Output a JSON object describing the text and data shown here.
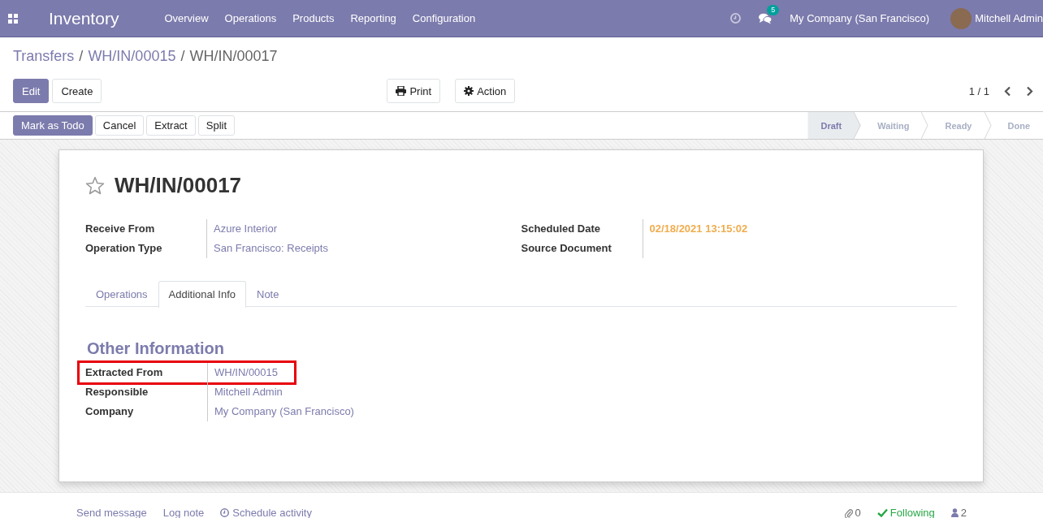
{
  "navbar": {
    "app_title": "Inventory",
    "menu": [
      "Overview",
      "Operations",
      "Products",
      "Reporting",
      "Configuration"
    ],
    "message_count": "5",
    "company": "My Company (San Francisco)",
    "user": "Mitchell Admin"
  },
  "breadcrumbs": [
    {
      "label": "Transfers",
      "current": false
    },
    {
      "separator": "/",
      "label": "WH/IN/00015",
      "current": false
    },
    {
      "separator": "/",
      "label": "WH/IN/00017",
      "current": true
    }
  ],
  "main_buttons": [
    {
      "label": "Edit",
      "primary": true
    },
    {
      "label": "Create",
      "primary": false
    }
  ],
  "dropdowns": [
    {
      "label": "Print",
      "kind": "print"
    },
    {
      "label": "Action",
      "kind": "gear"
    }
  ],
  "pager": "1 / 1",
  "header_buttons": [
    {
      "label": "Mark as Todo",
      "primary": true
    },
    {
      "label": "Cancel",
      "primary": false
    },
    {
      "label": "Extract",
      "primary": false
    },
    {
      "label": "Split",
      "primary": false
    }
  ],
  "statusbar": [
    {
      "label": "Draft",
      "selected": true
    },
    {
      "label": "Waiting",
      "selected": false
    },
    {
      "label": "Ready",
      "selected": false
    },
    {
      "label": "Done",
      "selected": false
    }
  ],
  "record": {
    "title": "WH/IN/00017",
    "starred": false,
    "left_fields": [
      {
        "label": "Receive From",
        "value": "Azure Interior",
        "kind": "link"
      },
      {
        "label": "Operation Type",
        "value": "San Francisco: Receipts",
        "kind": "link"
      }
    ],
    "right_fields": [
      {
        "label": "Scheduled Date",
        "value": "02/18/2021 13:15:02",
        "kind": "date"
      },
      {
        "label": "Source Document",
        "kind": "text"
      }
    ],
    "tabs": [
      {
        "label": "Operations",
        "selected": false
      },
      {
        "label": "Additional Info",
        "selected": true
      },
      {
        "label": "Note",
        "selected": false
      }
    ],
    "section_title": "Other Information",
    "info_fields": [
      {
        "label": "Extracted From",
        "value": "WH/IN/00015",
        "highlighted": true
      },
      {
        "label": "Responsible",
        "value": "Mitchell Admin",
        "highlighted": false
      },
      {
        "label": "Company",
        "value": "My Company (San Francisco)",
        "highlighted": false
      }
    ]
  },
  "chatter": {
    "actions": [
      {
        "label": "Send message",
        "kind": "plain"
      },
      {
        "label": "Log note",
        "kind": "plain"
      },
      {
        "label": "Schedule activity",
        "kind": "clock"
      }
    ],
    "attachments": "0",
    "follow_label": "Following",
    "followers": "2"
  }
}
